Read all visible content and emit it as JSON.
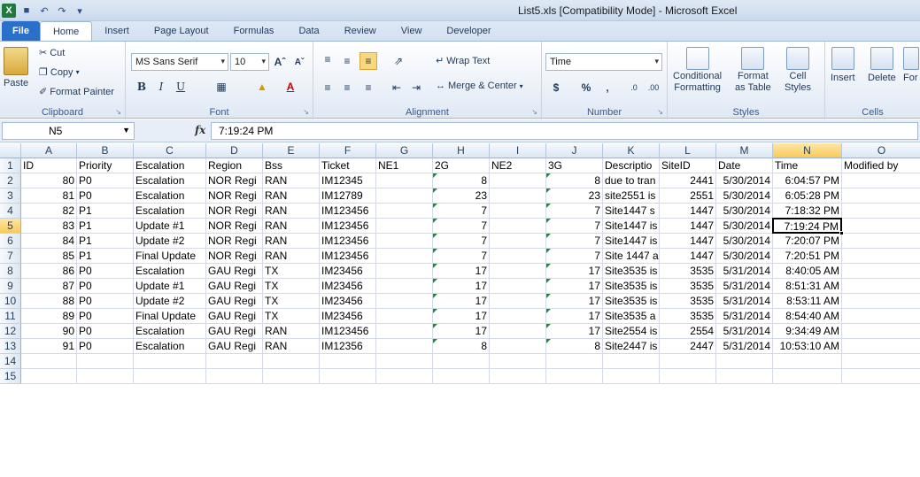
{
  "window": {
    "title": "List5.xls  [Compatibility Mode]  -  Microsoft Excel"
  },
  "tabs": [
    "File",
    "Home",
    "Insert",
    "Page Layout",
    "Formulas",
    "Data",
    "Review",
    "View",
    "Developer"
  ],
  "ribbon": {
    "clipboard": {
      "paste": "Paste",
      "cut": "Cut",
      "copy": "Copy",
      "format_painter": "Format Painter",
      "label": "Clipboard"
    },
    "font": {
      "name": "MS Sans Serif",
      "size": "10",
      "label": "Font"
    },
    "alignment": {
      "wrap": "Wrap Text",
      "merge": "Merge & Center",
      "label": "Alignment"
    },
    "number": {
      "format": "Time",
      "label": "Number"
    },
    "styles": {
      "conditional": "Conditional",
      "conditional2": "Formatting",
      "format": "Format",
      "format2": "as Table",
      "cell": "Cell",
      "cell2": "Styles",
      "label": "Styles"
    },
    "cells": {
      "insert": "Insert",
      "delete": "Delete",
      "format": "For",
      "label": "Cells"
    }
  },
  "formula_bar": {
    "name_box": "N5",
    "fx": "fx",
    "value": "7:19:24 PM"
  },
  "sheet": {
    "columns": [
      "A",
      "B",
      "C",
      "D",
      "E",
      "F",
      "G",
      "H",
      "I",
      "J",
      "K",
      "L",
      "M",
      "N",
      "O"
    ],
    "row_numbers": [
      "1",
      "2",
      "3",
      "4",
      "5",
      "6",
      "7",
      "8",
      "9",
      "10",
      "11",
      "12",
      "13",
      "14",
      "15"
    ],
    "rows": [
      [
        "ID",
        "Priority",
        "Escalation",
        "Region",
        "Bss",
        "Ticket",
        "NE1",
        "2G",
        "NE2",
        "3G",
        "Descriptio",
        "SiteID",
        "Date",
        "Time",
        "Modified by"
      ],
      [
        "80",
        "P0",
        "Escalation",
        "NOR Regi",
        "RAN",
        "IM12345",
        "",
        "8",
        "",
        "8",
        "due to tran",
        "2441",
        "5/30/2014",
        "6:04:57 PM",
        ""
      ],
      [
        "81",
        "P0",
        "Escalation",
        "NOR Regi",
        "RAN",
        "IM12789",
        "",
        "23",
        "",
        "23",
        "site2551 is",
        "2551",
        "5/30/2014",
        "6:05:28 PM",
        ""
      ],
      [
        "82",
        "P1",
        "Escalation",
        "NOR Regi",
        "RAN",
        "IM123456",
        "",
        "7",
        "",
        "7",
        "Site1447 s",
        "1447",
        "5/30/2014",
        "7:18:32 PM",
        ""
      ],
      [
        "83",
        "P1",
        "Update #1",
        "NOR Regi",
        "RAN",
        "IM123456",
        "",
        "7",
        "",
        "7",
        "Site1447 is",
        "1447",
        "5/30/2014",
        "7:19:24 PM",
        ""
      ],
      [
        "84",
        "P1",
        "Update #2",
        "NOR Regi",
        "RAN",
        "IM123456",
        "",
        "7",
        "",
        "7",
        "Site1447 is",
        "1447",
        "5/30/2014",
        "7:20:07 PM",
        ""
      ],
      [
        "85",
        "P1",
        "Final Update",
        "NOR Regi",
        "RAN",
        "IM123456",
        "",
        "7",
        "",
        "7",
        "Site 1447 a",
        "1447",
        "5/30/2014",
        "7:20:51 PM",
        ""
      ],
      [
        "86",
        "P0",
        "Escalation",
        "GAU Regi",
        "TX",
        "IM23456",
        "",
        "17",
        "",
        "17",
        "Site3535 is",
        "3535",
        "5/31/2014",
        "8:40:05 AM",
        ""
      ],
      [
        "87",
        "P0",
        "Update #1",
        "GAU Regi",
        "TX",
        "IM23456",
        "",
        "17",
        "",
        "17",
        "Site3535 is",
        "3535",
        "5/31/2014",
        "8:51:31 AM",
        ""
      ],
      [
        "88",
        "P0",
        "Update #2",
        "GAU Regi",
        "TX",
        "IM23456",
        "",
        "17",
        "",
        "17",
        "Site3535 is",
        "3535",
        "5/31/2014",
        "8:53:11 AM",
        ""
      ],
      [
        "89",
        "P0",
        "Final Update",
        "GAU Regi",
        "TX",
        "IM23456",
        "",
        "17",
        "",
        "17",
        "Site3535 a",
        "3535",
        "5/31/2014",
        "8:54:40 AM",
        ""
      ],
      [
        "90",
        "P0",
        "Escalation",
        "GAU Regi",
        "RAN",
        "IM123456",
        "",
        "17",
        "",
        "17",
        "Site2554 is",
        "2554",
        "5/31/2014",
        "9:34:49 AM",
        ""
      ],
      [
        "91",
        "P0",
        "Escalation",
        "GAU Regi",
        "RAN",
        "IM12356",
        "",
        "8",
        "",
        "8",
        "Site2447 is",
        "2447",
        "5/31/2014",
        "10:53:10 AM",
        ""
      ],
      [
        "",
        "",
        "",
        "",
        "",
        "",
        "",
        "",
        "",
        "",
        "",
        "",
        "",
        "",
        ""
      ],
      [
        "",
        "",
        "",
        "",
        "",
        "",
        "",
        "",
        "",
        "",
        "",
        "",
        "",
        "",
        ""
      ]
    ],
    "active_cell": "N5"
  }
}
